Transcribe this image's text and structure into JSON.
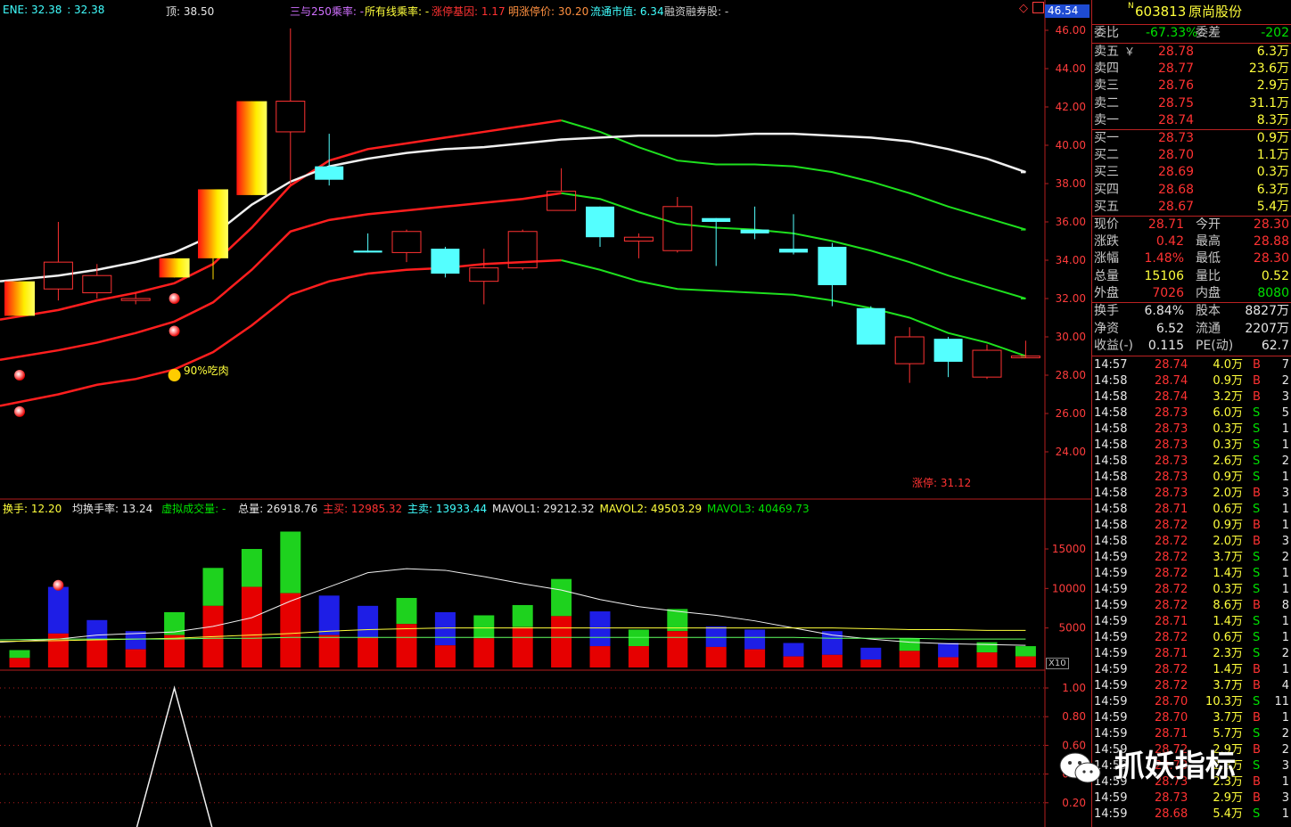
{
  "header": {
    "ene_label": "ENE: 32.38",
    "ene_val2": ": 32.38",
    "top": "顶: 38.50",
    "ratio_250": "三与250乘率: -",
    "all_line": "所有线乘率: -",
    "limit_gene": "涨停基因: 1.17",
    "tomorrow_limit": "明涨停价: 30.20",
    "float_mv": "流通市值: 6.34",
    "margin": "融资融券股: -",
    "price_box": "46.54"
  },
  "annotations": {
    "eat": "90%吃肉",
    "limit_up": "涨停: 31.12",
    "x10": "X10"
  },
  "vol_header": {
    "turnover": "换手: 12.20",
    "avg_turnover": "均换手率: 13.24",
    "virtual": "虚拟成交量: -",
    "total": "总量: 26918.76",
    "buy": "主买: 12985.32",
    "sell": "主卖: 13933.44",
    "mavol1": "MAVOL1: 29212.32",
    "mavol2": "MAVOL2: 49503.29",
    "mavol3": "MAVOL3: 40469.73"
  },
  "quote": {
    "code": "603813",
    "name": "原尚股份",
    "tag": "N",
    "weibi_label": "委比",
    "weibi": "-67.33%",
    "weicha_label": "委差",
    "weicha": "-202",
    "asks": [
      {
        "label": "卖五",
        "price": "28.78",
        "vol": "6.3万"
      },
      {
        "label": "卖四",
        "price": "28.77",
        "vol": "23.6万"
      },
      {
        "label": "卖三",
        "price": "28.76",
        "vol": "2.9万"
      },
      {
        "label": "卖二",
        "price": "28.75",
        "vol": "31.1万"
      },
      {
        "label": "卖一",
        "price": "28.74",
        "vol": "8.3万"
      }
    ],
    "ask_extra": "￥",
    "bids": [
      {
        "label": "买一",
        "price": "28.73",
        "vol": "0.9万"
      },
      {
        "label": "买二",
        "price": "28.70",
        "vol": "1.1万"
      },
      {
        "label": "买三",
        "price": "28.69",
        "vol": "0.3万"
      },
      {
        "label": "买四",
        "price": "28.68",
        "vol": "6.3万"
      },
      {
        "label": "买五",
        "price": "28.67",
        "vol": "5.4万"
      }
    ],
    "stats": [
      {
        "l1": "现价",
        "v1": "28.71",
        "l2": "今开",
        "v2": "28.30",
        "c1": "red",
        "c2": "red"
      },
      {
        "l1": "涨跌",
        "v1": "0.42",
        "l2": "最高",
        "v2": "28.88",
        "c1": "red",
        "c2": "red"
      },
      {
        "l1": "涨幅",
        "v1": "1.48%",
        "l2": "最低",
        "v2": "28.30",
        "c1": "red",
        "c2": "red"
      },
      {
        "l1": "总量",
        "v1": "15106",
        "l2": "量比",
        "v2": "0.52",
        "c1": "yellow",
        "c2": "yellow"
      },
      {
        "l1": "外盘",
        "v1": "7026",
        "l2": "内盘",
        "v2": "8080",
        "c1": "red",
        "c2": "green"
      }
    ],
    "stats2": [
      {
        "l1": "换手",
        "v1": "6.84%",
        "l2": "股本",
        "v2": "8827万"
      },
      {
        "l1": "净资",
        "v1": "6.52",
        "l2": "流通",
        "v2": "2207万"
      },
      {
        "l1": "收益(-)",
        "v1": "0.115",
        "l2": "PE(动)",
        "v2": "62.7"
      }
    ]
  },
  "ticks": [
    [
      "14:57",
      "28.74",
      "4.0万",
      "B",
      "7"
    ],
    [
      "14:58",
      "28.74",
      "0.9万",
      "B",
      "2"
    ],
    [
      "14:58",
      "28.74",
      "3.2万",
      "B",
      "3"
    ],
    [
      "14:58",
      "28.73",
      "6.0万",
      "S",
      "5"
    ],
    [
      "14:58",
      "28.73",
      "0.3万",
      "S",
      "1"
    ],
    [
      "14:58",
      "28.73",
      "0.3万",
      "S",
      "1"
    ],
    [
      "14:58",
      "28.73",
      "2.6万",
      "S",
      "2"
    ],
    [
      "14:58",
      "28.73",
      "0.9万",
      "S",
      "1"
    ],
    [
      "14:58",
      "28.73",
      "2.0万",
      "B",
      "3"
    ],
    [
      "14:58",
      "28.71",
      "0.6万",
      "S",
      "1"
    ],
    [
      "14:58",
      "28.72",
      "0.9万",
      "B",
      "1"
    ],
    [
      "14:58",
      "28.72",
      "2.0万",
      "B",
      "3"
    ],
    [
      "14:59",
      "28.72",
      "3.7万",
      "S",
      "2"
    ],
    [
      "14:59",
      "28.72",
      "1.4万",
      "S",
      "1"
    ],
    [
      "14:59",
      "28.72",
      "0.3万",
      "S",
      "1"
    ],
    [
      "14:59",
      "28.72",
      "8.6万",
      "B",
      "8"
    ],
    [
      "14:59",
      "28.71",
      "1.4万",
      "S",
      "1"
    ],
    [
      "14:59",
      "28.72",
      "0.6万",
      "S",
      "1"
    ],
    [
      "14:59",
      "28.71",
      "2.3万",
      "S",
      "2"
    ],
    [
      "14:59",
      "28.72",
      "1.4万",
      "B",
      "1"
    ],
    [
      "14:59",
      "28.72",
      "3.7万",
      "B",
      "4"
    ],
    [
      "14:59",
      "28.70",
      "10.3万",
      "S",
      "11"
    ],
    [
      "14:59",
      "28.70",
      "3.7万",
      "B",
      "1"
    ],
    [
      "14:59",
      "28.71",
      "5.7万",
      "S",
      "2"
    ],
    [
      "14:59",
      "28.72",
      "2.9万",
      "B",
      "2"
    ],
    [
      "14:59",
      "28.73",
      "2.3万",
      "S",
      "3"
    ],
    [
      "14:59",
      "28.73",
      "2.3万",
      "B",
      "1"
    ],
    [
      "14:59",
      "28.73",
      "2.9万",
      "B",
      "3"
    ],
    [
      "14:59",
      "28.68",
      "5.4万",
      "S",
      "1"
    ]
  ],
  "watermark": "抓妖指标",
  "chart_data": [
    {
      "type": "candlestick",
      "ylim": [
        23,
        47
      ],
      "yticks": [
        "24.00",
        "26.00",
        "28.00",
        "30.00",
        "32.00",
        "34.00",
        "36.00",
        "38.00",
        "40.00",
        "42.00",
        "44.00",
        "46.00"
      ],
      "candles": [
        {
          "o": 31.1,
          "c": 32.9,
          "h": 32.9,
          "l": 31.1,
          "limit": true
        },
        {
          "o": 32.5,
          "c": 33.9,
          "h": 36.0,
          "l": 31.9
        },
        {
          "o": 32.3,
          "c": 33.2,
          "h": 33.8,
          "l": 32.0
        },
        {
          "o": 31.9,
          "c": 32.0,
          "h": 32.3,
          "l": 31.7
        },
        {
          "o": 33.1,
          "c": 34.1,
          "h": 34.1,
          "l": 33.1,
          "limit": true
        },
        {
          "o": 34.1,
          "c": 37.7,
          "h": 37.7,
          "l": 33.0,
          "limit": true
        },
        {
          "o": 37.4,
          "c": 42.3,
          "h": 42.3,
          "l": 37.4,
          "limit": true
        },
        {
          "o": 40.7,
          "c": 42.3,
          "h": 46.1,
          "l": 37.9
        },
        {
          "o": 38.9,
          "c": 38.2,
          "h": 40.6,
          "l": 37.9
        },
        {
          "o": 34.5,
          "c": 34.4,
          "h": 35.4,
          "l": 34.4
        },
        {
          "o": 34.4,
          "c": 35.5,
          "h": 35.6,
          "l": 33.9
        },
        {
          "o": 34.6,
          "c": 33.3,
          "h": 34.7,
          "l": 33.1
        },
        {
          "o": 32.9,
          "c": 33.6,
          "h": 34.6,
          "l": 31.7
        },
        {
          "o": 33.6,
          "c": 35.5,
          "h": 35.6,
          "l": 33.5
        },
        {
          "o": 36.6,
          "c": 37.6,
          "h": 38.8,
          "l": 36.6
        },
        {
          "o": 36.8,
          "c": 35.2,
          "h": 36.8,
          "l": 34.7
        },
        {
          "o": 35.0,
          "c": 35.2,
          "h": 35.4,
          "l": 34.1
        },
        {
          "o": 34.5,
          "c": 36.8,
          "h": 37.3,
          "l": 34.4
        },
        {
          "o": 36.2,
          "c": 36.0,
          "h": 36.2,
          "l": 33.7
        },
        {
          "o": 35.6,
          "c": 35.4,
          "h": 36.8,
          "l": 35.1
        },
        {
          "o": 34.6,
          "c": 34.4,
          "h": 36.4,
          "l": 34.3
        },
        {
          "o": 34.7,
          "c": 32.7,
          "h": 34.9,
          "l": 31.6
        },
        {
          "o": 31.5,
          "c": 29.6,
          "h": 31.6,
          "l": 29.6
        },
        {
          "o": 28.6,
          "c": 30.0,
          "h": 30.5,
          "l": 27.6
        },
        {
          "o": 29.9,
          "c": 28.7,
          "h": 30.0,
          "l": 27.9
        },
        {
          "o": 27.9,
          "c": 29.3,
          "h": 29.6,
          "l": 27.8
        },
        {
          "o": 29.0,
          "c": 29.0,
          "h": 29.8,
          "l": 28.9
        }
      ],
      "white_line": [
        32.9,
        33.2,
        33.5,
        33.9,
        34.4,
        35.3,
        36.9,
        38.1,
        38.9,
        39.3,
        39.6,
        39.8,
        39.9,
        40.1,
        40.3,
        40.4,
        40.5,
        40.5,
        40.5,
        40.6,
        40.6,
        40.5,
        40.4,
        40.2,
        39.8,
        39.3,
        38.6
      ],
      "upper_band": [
        30.9,
        31.4,
        31.9,
        32.3,
        32.8,
        33.8,
        35.7,
        37.9,
        39.2,
        39.8,
        40.1,
        40.4,
        40.7,
        41.0,
        41.3,
        40.7,
        39.9,
        39.2,
        39.0,
        39.0,
        38.9,
        38.6,
        38.1,
        37.5,
        36.8,
        36.2,
        35.6
      ],
      "mid_band": [
        28.8,
        29.3,
        29.7,
        30.2,
        30.8,
        31.8,
        33.5,
        35.5,
        36.1,
        36.4,
        36.6,
        36.8,
        37.0,
        37.2,
        37.5,
        37.2,
        36.5,
        35.9,
        35.7,
        35.6,
        35.4,
        35.0,
        34.5,
        33.9,
        33.2,
        32.6,
        32.0
      ],
      "lower_band": [
        26.4,
        27.0,
        27.5,
        27.8,
        28.3,
        29.2,
        30.6,
        32.2,
        32.9,
        33.3,
        33.5,
        33.6,
        33.8,
        33.9,
        34.0,
        33.5,
        32.9,
        32.5,
        32.4,
        32.3,
        32.2,
        31.9,
        31.5,
        31.0,
        30.2,
        29.7,
        29.0
      ],
      "band_switch_index": 14,
      "markers": [
        {
          "i": 0,
          "y": 28.0
        },
        {
          "i": 0,
          "y": 26.1
        },
        {
          "i": 4,
          "y": 32.0
        },
        {
          "i": 4,
          "y": 30.3
        }
      ],
      "smiley": {
        "i": 4,
        "y": 28.0
      }
    },
    {
      "type": "bar",
      "ylim": [
        0,
        20000
      ],
      "yticks": [
        "5000",
        "10000",
        "15000"
      ],
      "volume_total": [
        2200,
        10200,
        6000,
        4600,
        7000,
        12600,
        15000,
        17200,
        9100,
        7800,
        8800,
        7000,
        6600,
        7900,
        11200,
        7100,
        4800,
        7400,
        5200,
        4800,
        3100,
        4600,
        2500,
        3700,
        3100,
        3200,
        2700
      ],
      "volume_red": [
        1200,
        4300,
        3500,
        2300,
        4100,
        7800,
        10200,
        9400,
        4100,
        3800,
        5500,
        2800,
        3700,
        5100,
        6500,
        2700,
        2700,
        4600,
        2600,
        2300,
        1400,
        1600,
        1000,
        2100,
        1300,
        1900,
        1400
      ],
      "volume_top_color": [
        "green",
        "blue",
        "blue",
        "blue",
        "green",
        "green",
        "green",
        "green",
        "blue",
        "blue",
        "green",
        "blue",
        "green",
        "green",
        "green",
        "blue",
        "green",
        "green",
        "blue",
        "blue",
        "blue",
        "blue",
        "blue",
        "green",
        "blue",
        "green",
        "green"
      ],
      "white_line": [
        3200,
        3600,
        4100,
        4300,
        4500,
        5200,
        6300,
        8400,
        10200,
        12000,
        12500,
        12300,
        11500,
        10600,
        9800,
        8600,
        7700,
        7100,
        6600,
        5900,
        5000,
        4100,
        3600,
        3200,
        3000,
        2900,
        2800
      ],
      "yellow_line": [
        3300,
        3400,
        3500,
        3600,
        3700,
        3900,
        4100,
        4300,
        4600,
        4800,
        4900,
        5000,
        5000,
        5000,
        5000,
        5000,
        5000,
        5000,
        5000,
        5000,
        5000,
        5000,
        4900,
        4800,
        4800,
        4700,
        4700
      ],
      "green_line": [
        3500,
        3600,
        3600,
        3600,
        3600,
        3700,
        3700,
        3800,
        3800,
        3800,
        3800,
        3800,
        3800,
        3800,
        3800,
        3800,
        3800,
        3800,
        3800,
        3800,
        3800,
        3700,
        3700,
        3700,
        3600,
        3600,
        3600
      ],
      "markers": [
        {
          "i": 1,
          "y": 10400
        }
      ]
    },
    {
      "type": "line",
      "ylim": [
        0,
        1.1
      ],
      "yticks": [
        "0.20",
        "0.40",
        "0.60",
        "0.80",
        "1.00"
      ],
      "values": [
        0,
        0,
        0,
        0,
        1.0,
        0,
        0,
        0,
        0,
        0,
        0,
        0,
        0,
        0,
        0,
        0,
        0,
        0,
        0,
        0,
        0,
        0,
        0,
        0,
        0,
        0,
        0
      ]
    }
  ]
}
